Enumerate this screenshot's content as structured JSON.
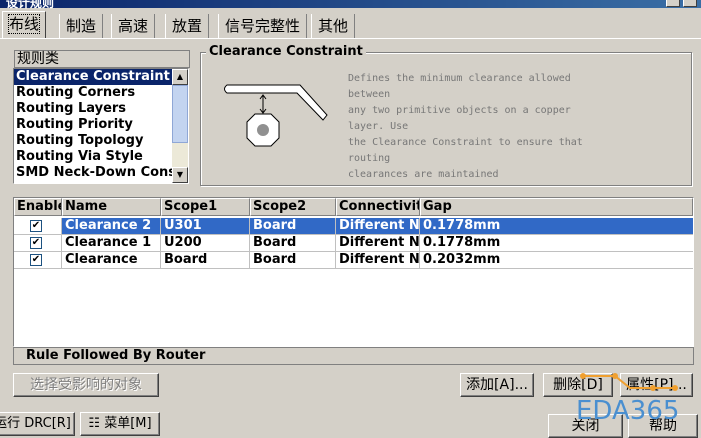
{
  "window": {
    "title": "设计规则"
  },
  "tabs": [
    {
      "label": "布线",
      "active": true
    },
    {
      "label": "制造",
      "active": false
    },
    {
      "label": "高速",
      "active": false
    },
    {
      "label": "放置",
      "active": false
    },
    {
      "label": "信号完整性",
      "active": false
    },
    {
      "label": "其他",
      "active": false
    }
  ],
  "rule_classes": {
    "label": "规则类",
    "items": [
      "Clearance Constraint",
      "Routing Corners",
      "Routing Layers",
      "Routing Priority",
      "Routing Topology",
      "Routing Via Style",
      "SMD Neck-Down Constraint"
    ],
    "selected_index": 0
  },
  "constraint": {
    "title": "Clearance Constraint",
    "description_lines": [
      "Defines the minimum clearance allowed",
      "between",
      "any two primitive objects on a copper",
      "layer. Use",
      "the Clearance Constraint to ensure that",
      "routing",
      "clearances are maintained"
    ]
  },
  "rules_table": {
    "headers": [
      "Enable",
      "Name",
      "Scope1",
      "Scope2",
      "Connectivity",
      "Gap"
    ],
    "rows": [
      {
        "enabled": true,
        "name": "Clearance  2",
        "scope1": "U301",
        "scope2": "Board",
        "connectivity": "Different Nets",
        "gap": "0.1778mm"
      },
      {
        "enabled": true,
        "name": "Clearance  1",
        "scope1": "U200",
        "scope2": "Board",
        "connectivity": "Different Nets",
        "gap": "0.1778mm"
      },
      {
        "enabled": true,
        "name": "Clearance",
        "scope1": "Board",
        "scope2": "Board",
        "connectivity": "Different Nets",
        "gap": "0.2032mm"
      }
    ],
    "selected_row": 0,
    "status": "Rule Followed By Router"
  },
  "buttons": {
    "select_affected": "选择受影响的对象",
    "add": "添加[A]...",
    "delete": "删除[D]",
    "properties": "属性[P]...",
    "run_drc": "运行 DRC[R]",
    "menu": "菜单[M]",
    "close": "关闭",
    "help": "帮助"
  },
  "watermark": "EDA365",
  "colors": {
    "selection": "#3169c6",
    "list_selection": "#0a246a",
    "face": "#d4d0c8",
    "watermark": "#4a8fd0"
  }
}
